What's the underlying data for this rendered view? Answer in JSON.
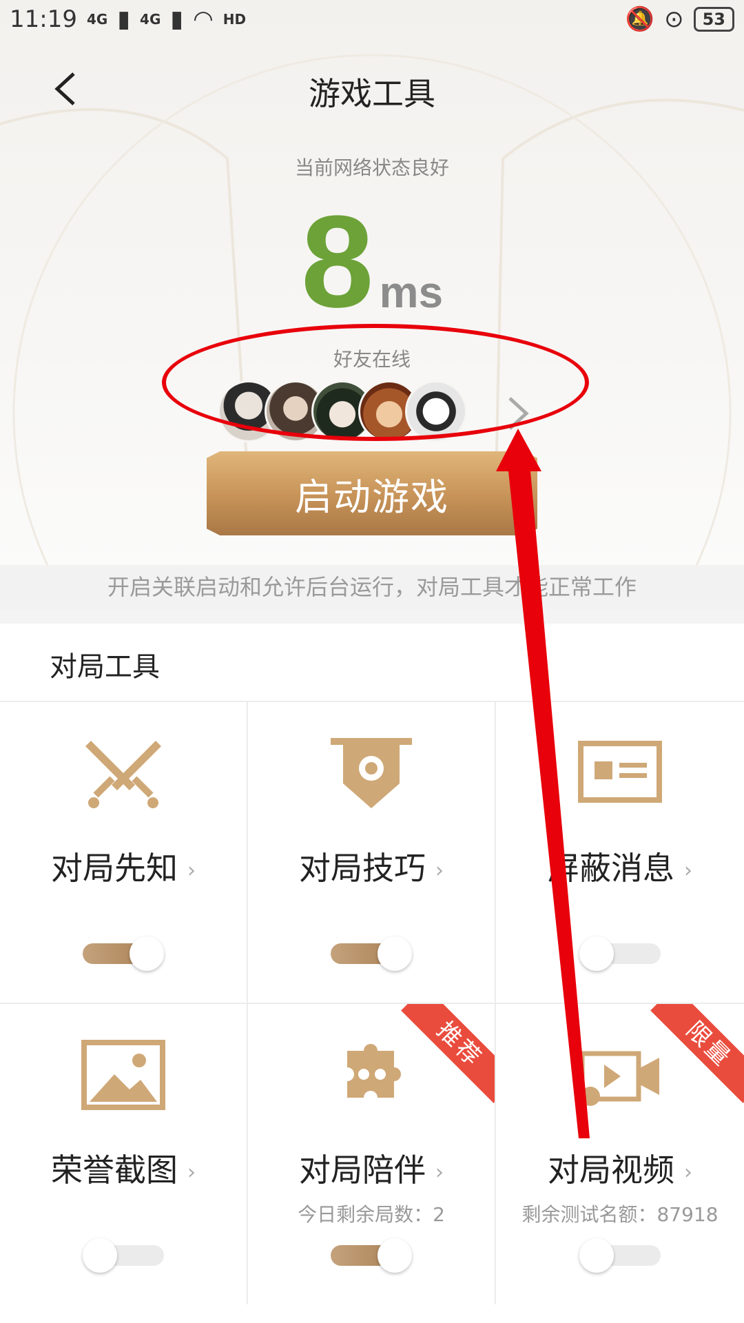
{
  "status_bar": {
    "time": "11:19",
    "net1": "4G",
    "net2": "4G",
    "hd": "HD",
    "battery": "53"
  },
  "header": {
    "title": "游戏工具"
  },
  "network": {
    "status_text": "当前网络状态良好",
    "latency_value": "8",
    "latency_unit": "ms"
  },
  "friends": {
    "label": "好友在线",
    "avatars": [
      "avatar-1",
      "avatar-2",
      "avatar-3",
      "avatar-4",
      "avatar-5"
    ]
  },
  "launch_button": {
    "label": "启动游戏"
  },
  "hint": {
    "text": "开启关联启动和允许后台运行，对局工具才能正常工作"
  },
  "tools_section": {
    "title": "对局工具",
    "items": [
      {
        "label": "对局先知",
        "sub": "",
        "enabled": true,
        "badge": "",
        "icon": "crossed-swords-icon"
      },
      {
        "label": "对局技巧",
        "sub": "",
        "enabled": true,
        "badge": "",
        "icon": "banner-shield-icon"
      },
      {
        "label": "屏蔽消息",
        "sub": "",
        "enabled": false,
        "badge": "",
        "icon": "message-block-icon"
      },
      {
        "label": "荣誉截图",
        "sub": "",
        "enabled": false,
        "badge": "",
        "icon": "image-icon"
      },
      {
        "label": "对局陪伴",
        "sub": "今日剩余局数：2",
        "enabled": true,
        "badge": "推荐",
        "icon": "puzzle-icon"
      },
      {
        "label": "对局视频",
        "sub": "剩余测试名额：87918",
        "enabled": false,
        "badge": "限量",
        "icon": "video-camera-icon"
      }
    ]
  },
  "colors": {
    "latency_green": "#6ca238",
    "gold": "#c9955a",
    "annotation_red": "#e8000b",
    "badge_red": "#e94c3d"
  }
}
